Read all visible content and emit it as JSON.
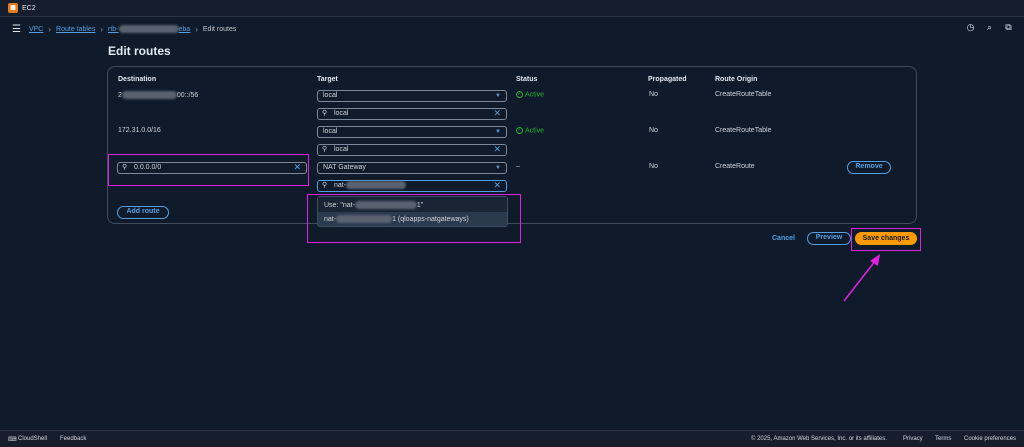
{
  "app": {
    "service": "EC2",
    "service_icon": "ec2-icon"
  },
  "breadcrumb": {
    "vpc": "VPC",
    "route_tables": "Route tables",
    "rtb_prefix": "rtb-",
    "rtb_suffix": "eba",
    "current": "Edit routes"
  },
  "page": {
    "title": "Edit routes"
  },
  "columns": {
    "destination": "Destination",
    "target": "Target",
    "status": "Status",
    "propagated": "Propagated",
    "route_origin": "Route Origin"
  },
  "routes": [
    {
      "destination_prefix": "2",
      "destination_suffix": "00::/56",
      "target": "local",
      "target_search": "local",
      "status": "Active",
      "propagated": "No",
      "origin": "CreateRouteTable"
    },
    {
      "destination": "172.31.0.0/16",
      "target": "local",
      "target_search": "local",
      "status": "Active",
      "propagated": "No",
      "origin": "CreateRouteTable"
    },
    {
      "destination": "0.0.0.0/0",
      "target": "NAT Gateway",
      "target_search_prefix": "nat-",
      "status": "–",
      "propagated": "No",
      "origin": "CreateRoute",
      "remove_label": "Remove"
    }
  ],
  "dropdown": {
    "use_prefix": "Use: \"nat-",
    "use_suffix": "1\"",
    "option_prefix": "nat-",
    "option_suffix": "1 (qloapps-natgateways)"
  },
  "actions": {
    "add_route": "Add route",
    "cancel": "Cancel",
    "preview": "Preview",
    "save": "Save changes"
  },
  "footer": {
    "cloudshell": "CloudShell",
    "feedback": "Feedback",
    "copyright": "© 2025, Amazon Web Services, Inc. or its affiliates.",
    "privacy": "Privacy",
    "terms": "Terms",
    "cookies": "Cookie preferences"
  },
  "colors": {
    "highlight": "#e020e0",
    "accent": "#539fe5",
    "primary": "#ff9900",
    "active": "#29ad32"
  }
}
